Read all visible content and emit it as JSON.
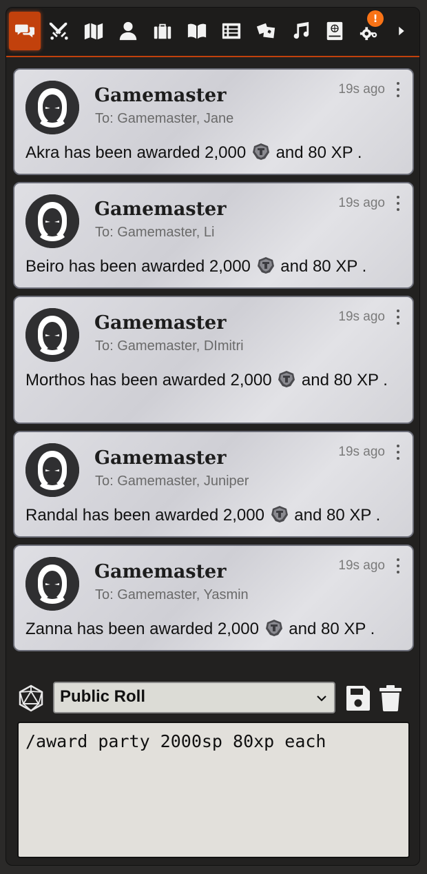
{
  "tabs": [
    {
      "icon": "chat-icon",
      "active": true
    },
    {
      "icon": "crossed-swords-icon"
    },
    {
      "icon": "map-icon"
    },
    {
      "icon": "person-icon"
    },
    {
      "icon": "briefcase-icon"
    },
    {
      "icon": "open-book-icon"
    },
    {
      "icon": "list-icon"
    },
    {
      "icon": "cards-icon"
    },
    {
      "icon": "music-note-icon"
    },
    {
      "icon": "compendium-icon"
    },
    {
      "icon": "gears-icon",
      "badge": "!"
    },
    {
      "icon": "chevron-right-icon"
    }
  ],
  "colors": {
    "accent": "#c2410c",
    "badge": "#f97316",
    "card_border": "#6b6d78"
  },
  "messages": [
    {
      "sender": "Gamemaster",
      "to": "To: Gamemaster, Jane",
      "time": "19s ago",
      "text_before": "Akra has been awarded 2,000",
      "text_after": "and 80 XP ."
    },
    {
      "sender": "Gamemaster",
      "to": "To: Gamemaster, Li",
      "time": "19s ago",
      "text_before": "Beiro has been awarded 2,000",
      "text_after": "and 80 XP ."
    },
    {
      "sender": "Gamemaster",
      "to": "To: Gamemaster, DImitri",
      "time": "19s ago",
      "text_before": "Morthos has been awarded 2,000",
      "text_after": "and 80 XP ."
    },
    {
      "sender": "Gamemaster",
      "to": "To: Gamemaster, Juniper",
      "time": "19s ago",
      "text_before": "Randal has been awarded 2,000",
      "text_after": "and 80 XP ."
    },
    {
      "sender": "Gamemaster",
      "to": "To: Gamemaster, Yasmin",
      "time": "19s ago",
      "text_before": "Zanna has been awarded 2,000",
      "text_after": "and 80 XP ."
    }
  ],
  "composer": {
    "roll_mode": "Public Roll",
    "input_value": "/award party 2000sp 80xp each"
  }
}
